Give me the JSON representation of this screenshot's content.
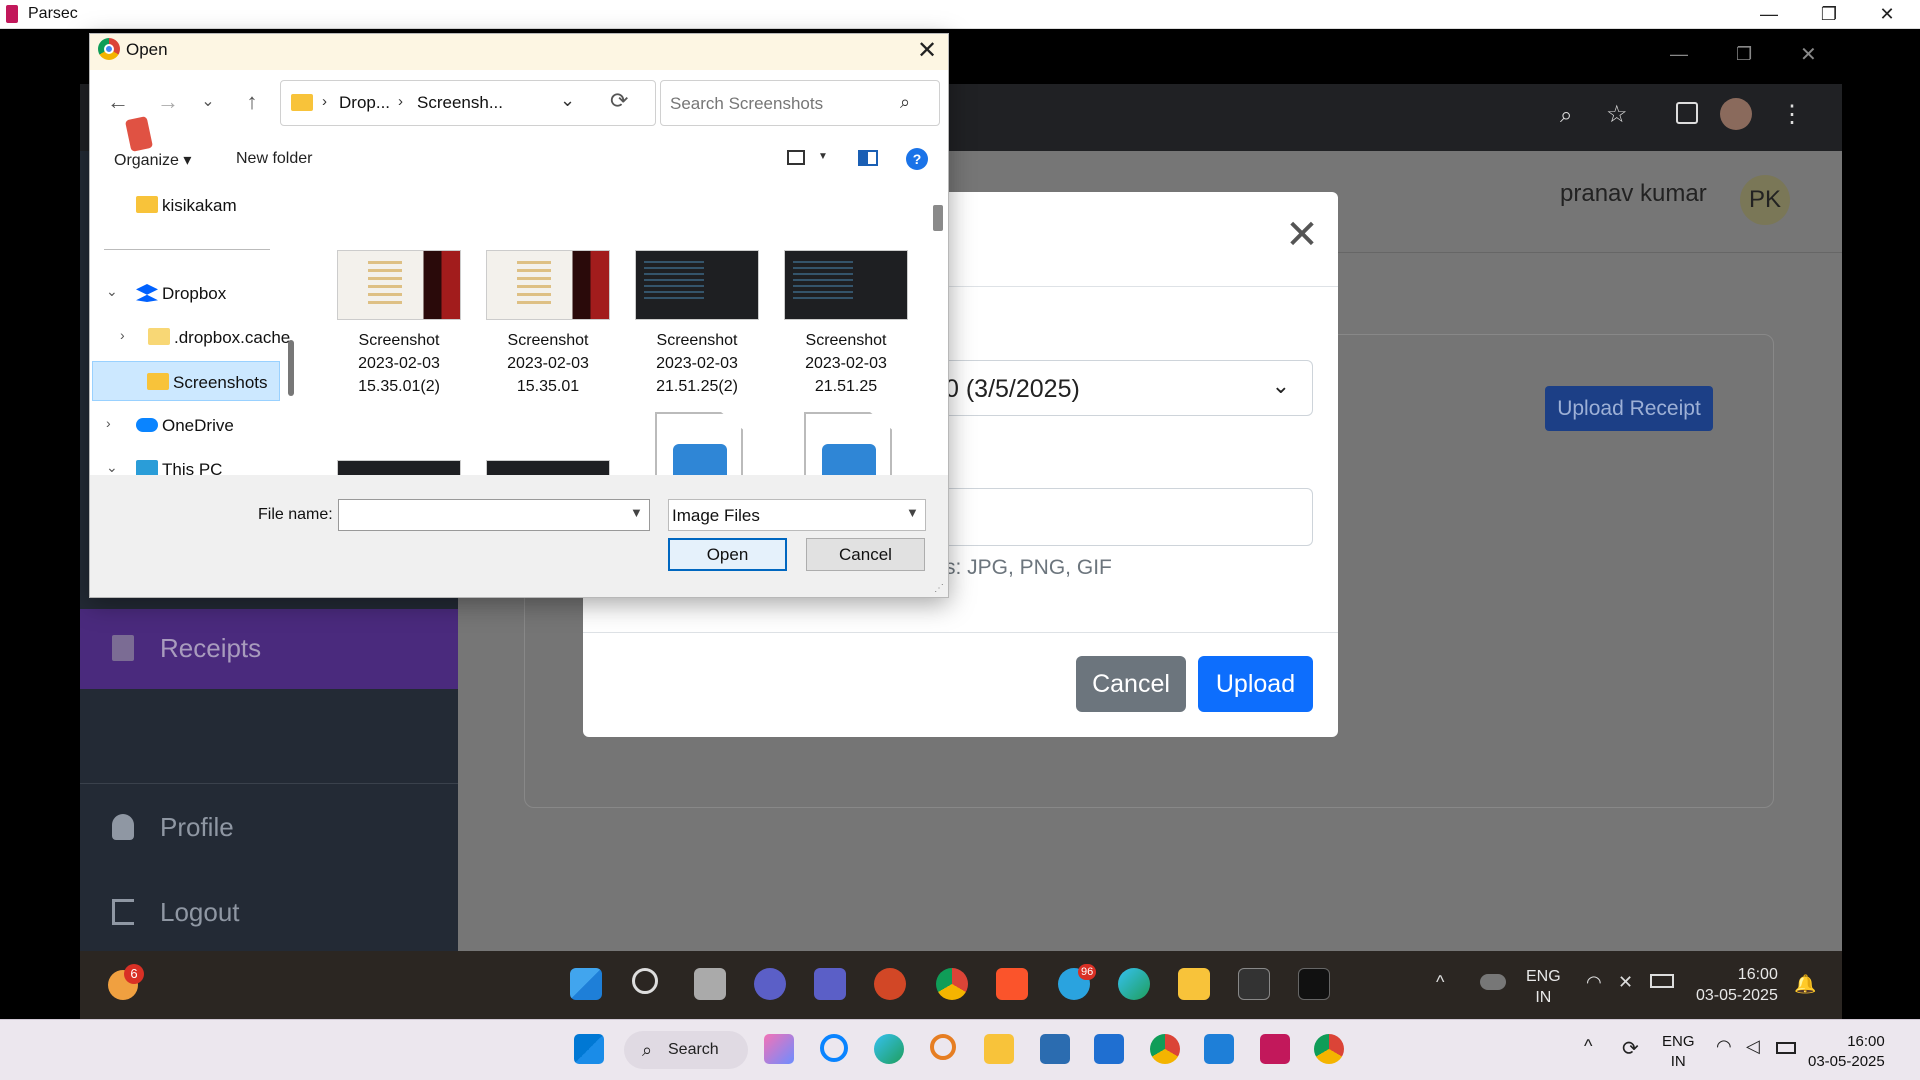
{
  "host_window": {
    "title": "Parsec",
    "minimize": "—",
    "restore": "❐",
    "close": "✕"
  },
  "remote_app": {
    "user_name": "pranav kumar",
    "user_initials": "PK",
    "sidebar": {
      "receipts": "Receipts",
      "profile": "Profile",
      "logout": "Logout"
    },
    "upload_receipt_button": "Upload Receipt",
    "modal": {
      "selected_option": "0 (3/5/2025)",
      "hint": "s: JPG, PNG, GIF",
      "cancel": "Cancel",
      "upload": "Upload"
    },
    "taskbar": {
      "weather_badge": "6",
      "lang": "ENG",
      "region": "IN",
      "time": "16:00",
      "date": "03-05-2025",
      "telegram_badge": "96"
    }
  },
  "open_dialog": {
    "title": "Open",
    "breadcrumbs": [
      "Drop...",
      "Screensh..."
    ],
    "search_placeholder": "Search Screenshots",
    "organize": "Organize ▾",
    "new_folder": "New folder",
    "help": "?",
    "nav_tree": [
      {
        "label": "kisikakam"
      },
      {
        "label": "Dropbox"
      },
      {
        "label": ".dropbox.cache"
      },
      {
        "label": "Screenshots"
      },
      {
        "label": "OneDrive"
      },
      {
        "label": "This PC"
      }
    ],
    "files": [
      {
        "line1": "Screenshot",
        "line2": "2023-02-03",
        "line3": "15.35.01(2)"
      },
      {
        "line1": "Screenshot",
        "line2": "2023-02-03",
        "line3": "15.35.01"
      },
      {
        "line1": "Screenshot",
        "line2": "2023-02-03",
        "line3": "21.51.25(2)"
      },
      {
        "line1": "Screenshot",
        "line2": "2023-02-03",
        "line3": "21.51.25"
      }
    ],
    "file_name_label": "File name:",
    "file_name_value": "",
    "file_type": "Image Files",
    "open_button": "Open",
    "cancel_button": "Cancel"
  },
  "host_taskbar": {
    "search_label": "Search",
    "lang": "ENG",
    "region": "IN",
    "time": "16:00",
    "date": "03-05-2025"
  }
}
